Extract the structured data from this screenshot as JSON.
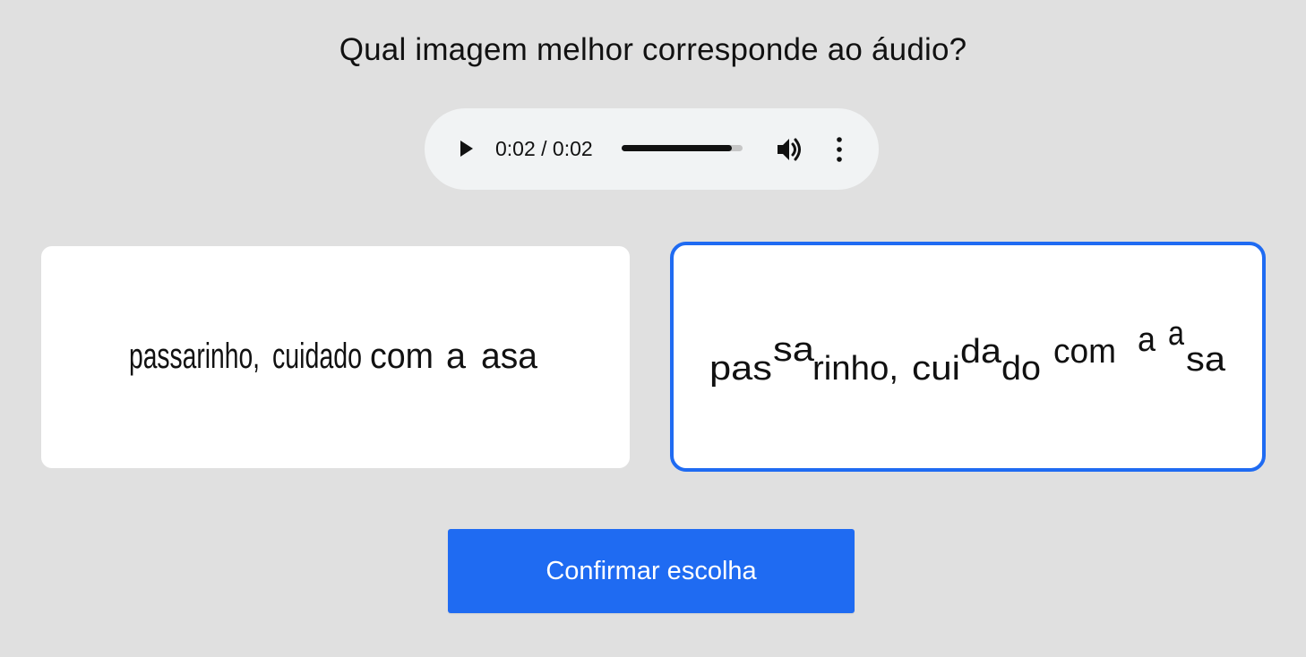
{
  "question": "Qual imagem melhor corresponde ao áudio?",
  "audio_player": {
    "time_display": "0:02 / 0:02",
    "progress": 0.91,
    "play_icon": "play-icon",
    "volume_icon": "volume-icon",
    "menu_icon": "more-vert-icon"
  },
  "options": [
    {
      "text": "passarinho, cuidado com a  asa",
      "selected": false,
      "words": [
        "passarinho,",
        "cuidado",
        "com",
        "a",
        "asa"
      ]
    },
    {
      "text": "passarinho, cuidado com a asa",
      "selected": true,
      "segments": [
        "pas",
        "sa",
        "rinho,",
        "cui",
        "da",
        "do",
        "com",
        "a",
        "a",
        "sa"
      ]
    }
  ],
  "confirm_label": "Confirmar escolha",
  "colors": {
    "accent": "#1f6bf2",
    "background": "#e0e0e0",
    "player_bg": "#f1f3f4"
  }
}
